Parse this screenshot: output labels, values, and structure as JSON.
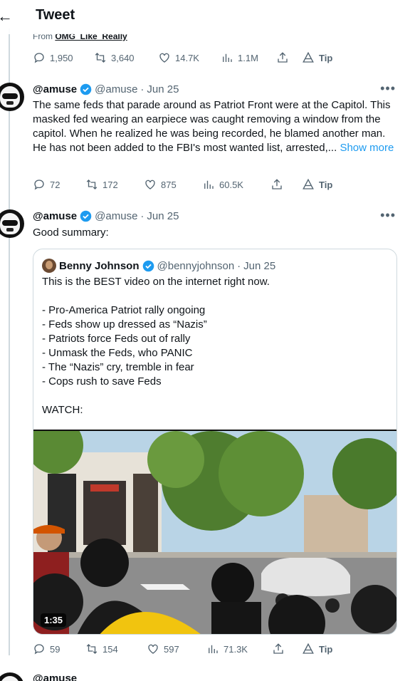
{
  "header": {
    "title": "Tweet",
    "back_icon": "back-arrow-icon"
  },
  "previous_tweet": {
    "from_prefix": "From",
    "from_source": "OMG_Like_Really",
    "actions": {
      "replies": "1,950",
      "retweets": "3,640",
      "likes": "14.7K",
      "views": "1.1M",
      "tip": "Tip"
    }
  },
  "tweet1": {
    "name": "@amuse",
    "handle": "@amuse",
    "date": "Jun 25",
    "text": "The same feds that parade around as Patriot Front were at the Capitol. This masked fed wearing an earpiece was caught removing a window from the capitol. When he realized he was being recorded, he  blamed another man. He has not been added to the FBI's most wanted list, arrested,...",
    "show_more": "Show more",
    "actions": {
      "replies": "72",
      "retweets": "172",
      "likes": "875",
      "views": "60.5K",
      "tip": "Tip"
    }
  },
  "tweet2": {
    "name": "@amuse",
    "handle": "@amuse",
    "date": "Jun 25",
    "text": "Good summary:",
    "quote": {
      "name": "Benny Johnson",
      "handle": "@bennyjohnson",
      "date": "Jun 25",
      "lines": [
        "This is the BEST video on the internet right now.",
        "",
        "- Pro-America Patriot rally ongoing",
        "- Feds show up dressed as “Nazis”",
        "- Patriots force Feds out of rally",
        "- Unmask the Feds, who PANIC",
        "- The “Nazis” cry, tremble in fear",
        "- Cops rush to save Feds",
        "",
        "WATCH:"
      ],
      "video_duration": "1:35"
    },
    "actions": {
      "replies": "59",
      "retweets": "154",
      "likes": "597",
      "views": "71.3K",
      "tip": "Tip"
    }
  },
  "tweet3_peek": {
    "name": "@amuse"
  },
  "colors": {
    "accent": "#1d9bf0",
    "text": "#0f1419",
    "secondary": "#536471",
    "border": "#cfd9de"
  }
}
